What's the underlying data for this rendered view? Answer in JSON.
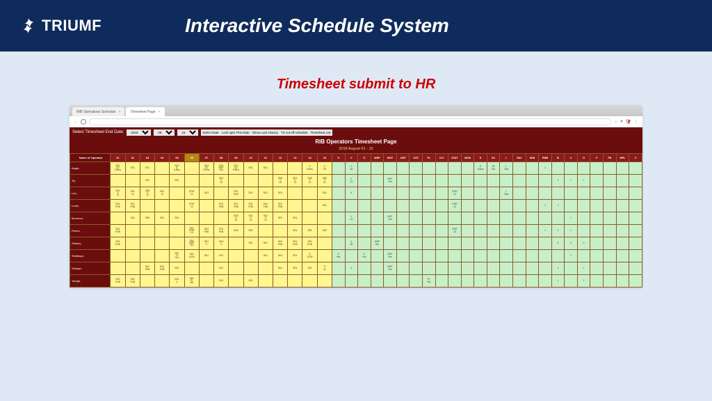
{
  "header": {
    "brand": "TRIUMF",
    "title": "Interactive Schedule System"
  },
  "subtitle": "Timesheet submit to HR",
  "browser": {
    "tabs": [
      {
        "label": "RIB Operations Schedule",
        "active": false
      },
      {
        "label": "Timesheet Page",
        "active": true
      }
    ],
    "url": ""
  },
  "controls": {
    "label": "Select Timesheet End Date:",
    "year": "2018",
    "month": "08",
    "day": "15",
    "buttons": [
      "Select Date",
      "Lock upto This Date",
      "Show Lock History",
      "TS cut-off schedule",
      "Timesheet List"
    ]
  },
  "page": {
    "title": "RIB Operators Timesheet Page",
    "date_range": "2018 August 01 - 15"
  },
  "columns": {
    "name": "Name of Operator",
    "days": [
      "01",
      "02",
      "03",
      "04",
      "05",
      "06",
      "07",
      "08",
      "09",
      "10",
      "11",
      "12",
      "13",
      "14",
      "15"
    ],
    "summary": [
      "S",
      "V",
      "O",
      "WSP",
      "WST",
      "OSP",
      "OST",
      "PL",
      "CLT",
      "STAT",
      "WCB",
      "E",
      "E2",
      "L",
      "SD1",
      "SD8",
      "PMB",
      "B",
      "C",
      "D",
      "F",
      "FR",
      "MPL",
      "X"
    ]
  },
  "operators": [
    {
      "name": "Auger,",
      "days": [
        "SD1 E2 5.5hrs",
        "SD1",
        "SD1",
        "",
        "SD1 E 5.5hrs",
        "",
        "SD1 E2 5.5hrs",
        "SD1 WST Hrs",
        "SD1 E2 5.5hrs",
        "SD1",
        "SD1",
        "",
        "",
        "V 5.5hrs",
        "V 28"
      ],
      "sum": [
        "",
        "V 28",
        "",
        "",
        "",
        "",
        "",
        "",
        "",
        "",
        "",
        "E 5.5hrs",
        "E2 Hrs",
        "L 2hrs",
        "",
        "",
        "1",
        "",
        "",
        "",
        "",
        "",
        "",
        ""
      ]
    },
    {
      "name": "Jin,",
      "days": [
        "",
        "",
        "SD1",
        "",
        "SD1",
        "",
        "",
        "SD1 V 14",
        "",
        "",
        "",
        "SD8 V 14",
        "SD1 V 14",
        "SD8 V 14",
        "SD8 V 14"
      ],
      "sum": [
        "",
        "V 14",
        "",
        "",
        "WST Hrs",
        "",
        "",
        "",
        "",
        "",
        "",
        "",
        "",
        "",
        "",
        "",
        "",
        "1",
        "1",
        "1",
        "",
        "",
        "",
        ""
      ]
    },
    {
      "name": "Lau,",
      "days": [
        "SD1 V 14",
        "SD1 14",
        "SD8 V 14",
        "SD1 14",
        "",
        "STAT 14",
        "SD1",
        "",
        "SD1 PUB",
        "SD1",
        "SD1",
        "SD1",
        "",
        "",
        "SD1"
      ],
      "sum": [
        "",
        "V",
        "",
        "",
        "",
        "",
        "",
        "",
        "",
        "STAT 14",
        "",
        "",
        "",
        "L 2hrs",
        "",
        "",
        "",
        "",
        "",
        "",
        "",
        "",
        "",
        ""
      ]
    },
    {
      "name": "Louie,",
      "days": [
        "SD1 PUB",
        "SD1 PUB",
        "",
        "",
        "",
        "STAT 14",
        "",
        "SD1 PUB",
        "SD1 PUB",
        "SD1 PUB",
        "SD1 PUB",
        "SD1 PUB",
        "",
        "",
        "SD1"
      ],
      "sum": [
        "",
        "",
        "",
        "",
        "",
        "",
        "",
        "",
        "",
        "STAT 14",
        "",
        "",
        "",
        "",
        "",
        "",
        "1",
        "1",
        "",
        "",
        "",
        "",
        "",
        ""
      ]
    },
    {
      "name": "Muromm,",
      "days": [
        "",
        "SD1",
        "SD8",
        "SD1",
        "SD1",
        "",
        "",
        "",
        "SD8 V 14",
        "SD1 V 14",
        "SD1 V 14",
        "SD1",
        "SD1",
        "",
        ""
      ],
      "sum": [
        "",
        "V 14",
        "",
        "",
        "WST Hrs",
        "",
        "",
        "",
        "",
        "",
        "",
        "",
        "",
        "",
        "",
        "",
        "",
        "",
        "1",
        "",
        "",
        "",
        "",
        ""
      ]
    },
    {
      "name": "Parton,",
      "days": [
        "SD1 PUB",
        "",
        "",
        "",
        "",
        "SD1 STAT 14",
        "SD1 PUB",
        "SD1 PUB",
        "SD8",
        "SD1",
        "",
        "",
        "SD1",
        "SD1",
        "SD2"
      ],
      "sum": [
        "",
        "",
        "",
        "",
        "",
        "",
        "",
        "",
        "",
        "STAT 14",
        "",
        "",
        "",
        "",
        "",
        "",
        "1",
        "1",
        "1",
        "",
        "",
        "",
        "",
        ""
      ]
    },
    {
      "name": "Shanks,",
      "days": [
        "SD1 PUB",
        "",
        "",
        "",
        "",
        "SD1 WSP Hrs",
        "SD1 V",
        "SD1 V",
        "",
        "SD1",
        "SD1",
        "SD1 PUB",
        "SD1 PUB",
        "SD1 PUB",
        ""
      ],
      "sum": [
        "",
        "V 28",
        "",
        "WSP Hrs",
        "",
        "",
        "",
        "",
        "",
        "",
        "",
        "",
        "",
        "",
        "",
        "",
        "",
        "4",
        "2",
        "4",
        "",
        "",
        "",
        ""
      ]
    },
    {
      "name": "Shelbaya,",
      "days": [
        "",
        "",
        "",
        "",
        "SD1 O Hrs",
        "SD1 5.234",
        "SD1",
        "SD1",
        "",
        "",
        "SD1",
        "SD1",
        "SD1",
        "S 5.234",
        ""
      ],
      "sum": [
        "S Hrs",
        "",
        "O Hrs",
        "",
        "WST Hrs",
        "",
        "",
        "",
        "",
        "",
        "",
        "",
        "",
        "",
        "",
        "",
        "",
        "",
        "1",
        "",
        "",
        "",
        "",
        ""
      ]
    },
    {
      "name": "Stringer,",
      "days": [
        "",
        "",
        "SD1 PUB",
        "SD1 PUB",
        "SD1",
        "",
        "",
        "SD1",
        "",
        "",
        "",
        "SD1",
        "SD1",
        "SD1",
        "S 14"
      ],
      "sum": [
        "",
        "V",
        "",
        "",
        "WSP Hrs",
        "",
        "",
        "",
        "",
        "",
        "",
        "",
        "",
        "",
        "",
        "",
        "",
        "1",
        "",
        "1",
        "",
        "",
        "",
        ""
      ]
    },
    {
      "name": "Tanaja,",
      "days": [
        "SD1 PUB",
        "SD1 PUB",
        "",
        "",
        "SD1 V",
        "SD1 PL Hrs",
        "",
        "SD1",
        "",
        "SD1",
        "",
        "",
        "",
        "",
        ""
      ],
      "sum": [
        "",
        "",
        "",
        "",
        "",
        "",
        "",
        "PL Hrs",
        "",
        "",
        "",
        "",
        "",
        "",
        "",
        "",
        "",
        "1",
        "",
        "1",
        "",
        "",
        "",
        ""
      ]
    }
  ]
}
